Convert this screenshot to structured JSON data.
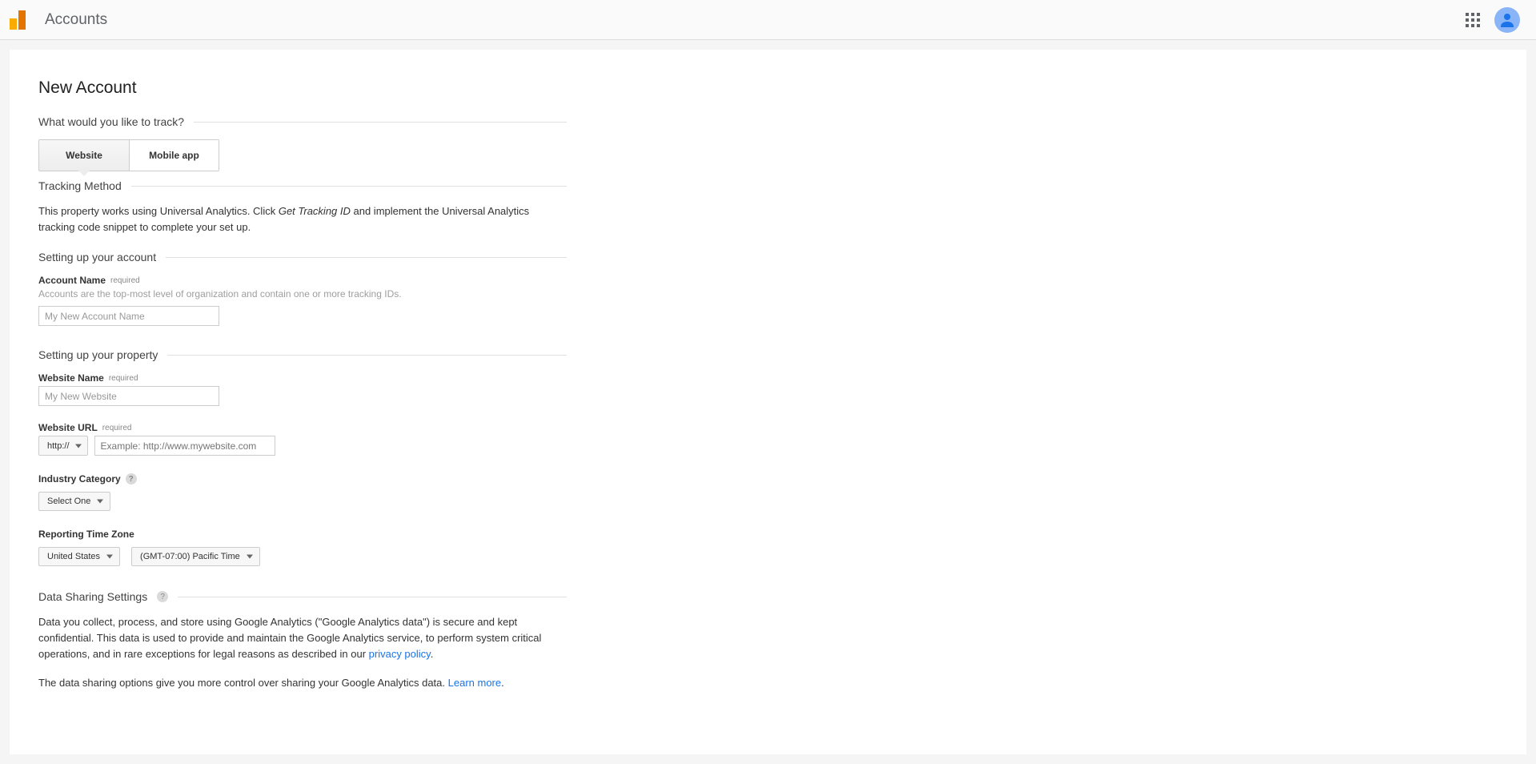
{
  "header": {
    "title": "Accounts"
  },
  "page": {
    "title": "New Account"
  },
  "sections": {
    "track_question": "What would you like to track?",
    "tracking_method": "Tracking Method",
    "setup_account": "Setting up your account",
    "setup_property": "Setting up your property",
    "data_sharing": "Data Sharing Settings"
  },
  "tabs": {
    "website": "Website",
    "mobile": "Mobile app"
  },
  "tracking": {
    "pre": "This property works using Universal Analytics. Click ",
    "cta": "Get Tracking ID",
    "post": " and implement the Universal Analytics tracking code snippet to complete your set up."
  },
  "fields": {
    "required": "required",
    "account_name_label": "Account Name",
    "account_name_help": "Accounts are the top-most level of organization and contain one or more tracking IDs.",
    "account_name_placeholder": "My New Account Name",
    "website_name_label": "Website Name",
    "website_name_placeholder": "My New Website",
    "website_url_label": "Website URL",
    "protocol": "http://",
    "website_url_placeholder": "Example: http://www.mywebsite.com",
    "industry_label": "Industry Category",
    "industry_value": "Select One",
    "tz_label": "Reporting Time Zone",
    "tz_country": "United States",
    "tz_value": "(GMT-07:00) Pacific Time"
  },
  "data_sharing": {
    "para": "Data you collect, process, and store using Google Analytics (\"Google Analytics data\") is secure and kept confidential. This data is used to provide and maintain the Google Analytics service, to perform system critical operations, and in rare exceptions for legal reasons as described in our ",
    "privacy_link": "privacy policy",
    "para2": "The data sharing options give you more control over sharing your Google Analytics data. ",
    "learn_more": "Learn more"
  }
}
